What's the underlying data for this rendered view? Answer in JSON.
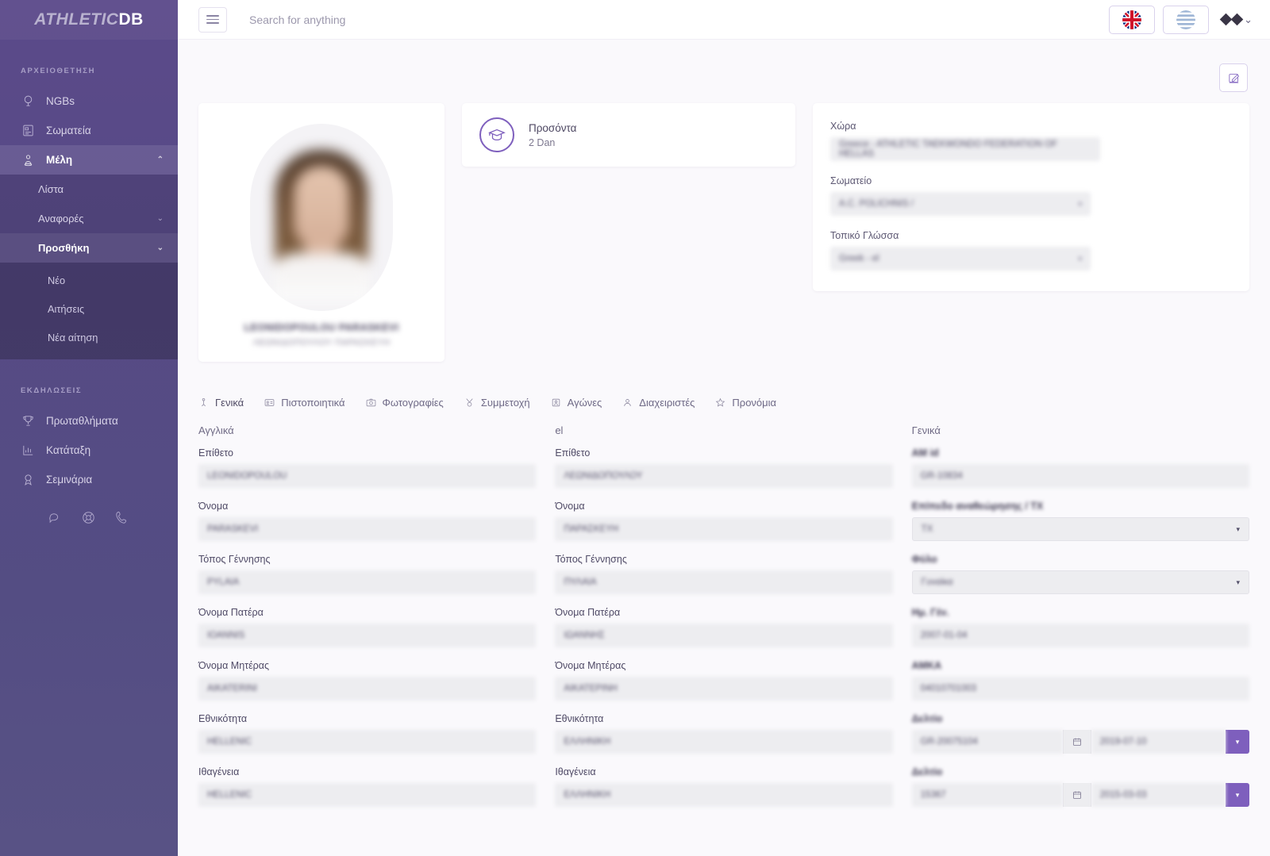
{
  "brand": {
    "part1": "ATHLETIC",
    "part2": "DB"
  },
  "sidebar": {
    "section1_title": "ΑΡΧΕΙΟΘΕΤΗΣΗ",
    "items": [
      {
        "label": "NGBs",
        "icon": "globe-icon"
      },
      {
        "label": "Σωματεία",
        "icon": "building-icon"
      },
      {
        "label": "Μέλη",
        "icon": "member-pin-icon",
        "chevron": "⌃"
      }
    ],
    "sub_items": [
      {
        "label": "Λίστα"
      },
      {
        "label": "Αναφορές",
        "chevron": "⌄"
      },
      {
        "label": "Προσθήκη",
        "chevron": "⌄"
      }
    ],
    "subsub_items": [
      {
        "label": "Νέο"
      },
      {
        "label": "Αιτήσεις"
      },
      {
        "label": "Νέα αίτηση"
      }
    ],
    "section2_title": "ΕΚΔΗΛΩΣΕΙΣ",
    "items2": [
      {
        "label": "Πρωταθλήματα",
        "icon": "trophy-icon"
      },
      {
        "label": "Κατάταξη",
        "icon": "bar-chart-icon"
      },
      {
        "label": "Σεμινάρια",
        "icon": "award-icon"
      }
    ],
    "social": [
      "chat-icon",
      "lifebuoy-icon",
      "phone-icon"
    ]
  },
  "topbar": {
    "search_placeholder": "Search for anything",
    "search_value": "",
    "lang_flag": "uk-flag-icon",
    "country_flag": "greece-flag-icon",
    "user_caret": "⌄"
  },
  "profile": {
    "name_latin": "LEONIDOPOULOU PARASKEVI",
    "name_greek": "ΛΕΩΝΙΔΟΠΟΥΛΟΥ ΠΑΡΑΣΚΕΥΗ"
  },
  "qualification": {
    "title": "Προσόντα",
    "value": "2 Dan",
    "icon": "graduation-cap-icon"
  },
  "org": {
    "country_label": "Χώρα",
    "country_value": "Greece - ATHLETIC TAEKWONDO FEDERATION OF HELLAS",
    "club_label": "Σωματείο",
    "club_value": "A.C. POLICHNIS /",
    "locale_label": "Τοπικό Γλώσσα",
    "locale_value": "Greek - el"
  },
  "tabs": [
    {
      "label": "Γενικά",
      "icon": "person-icon",
      "active": true
    },
    {
      "label": "Πιστοποιητικά",
      "icon": "card-icon"
    },
    {
      "label": "Φωτογραφίες",
      "icon": "camera-icon"
    },
    {
      "label": "Συμμετοχή",
      "icon": "medal-icon"
    },
    {
      "label": "Αγώνες",
      "icon": "contest-icon"
    },
    {
      "label": "Διαχειριστές",
      "icon": "user-icon"
    },
    {
      "label": "Προνόμια",
      "icon": "star-icon"
    }
  ],
  "form": {
    "col1": {
      "header": "Αγγλικά",
      "rows": [
        {
          "label": "Επίθετο",
          "value": "LEONIDOPOULOU"
        },
        {
          "label": "Όνομα",
          "value": "PARASKEVI"
        },
        {
          "label": "Τόπος Γέννησης",
          "value": "PYLAIA"
        },
        {
          "label": "Όνομα Πατέρα",
          "value": "IOANNIS"
        },
        {
          "label": "Όνομα Μητέρας",
          "value": "AIKATERINI"
        },
        {
          "label": "Εθνικότητα",
          "value": "HELLENIC"
        },
        {
          "label": "Ιθαγένεια",
          "value": "HELLENIC"
        }
      ]
    },
    "col2": {
      "header": "el",
      "rows": [
        {
          "label": "Επίθετο",
          "value": "ΛΕΩΝΙΔΟΠΟΥΛΟΥ"
        },
        {
          "label": "Όνομα",
          "value": "ΠΑΡΑΣΚΕΥΗ"
        },
        {
          "label": "Τόπος Γέννησης",
          "value": "ΠΥΛΑΙΑ"
        },
        {
          "label": "Όνομα Πατέρα",
          "value": "ΙΩΑΝΝΗΣ"
        },
        {
          "label": "Όνομα Μητέρας",
          "value": "ΑΙΚΑΤΕΡΙΝΗ"
        },
        {
          "label": "Εθνικότητα",
          "value": "ΕΛΛΗΝΙΚΗ"
        },
        {
          "label": "Ιθαγένεια",
          "value": "ΕΛΛΗΝΙΚΗ"
        }
      ]
    },
    "col3": {
      "header": "Γενικά",
      "rows": [
        {
          "label": "ΑΜ id",
          "value": "GR-10834",
          "type": "text"
        },
        {
          "label": "Επίπεδο αναθεώρησης / ΤΧ",
          "value": "ΤΧ",
          "type": "select"
        },
        {
          "label": "Φύλο",
          "value": "Γυναίκα",
          "type": "select"
        },
        {
          "label": "Ημ. Γέν.",
          "value": "2007-01-04",
          "type": "text"
        },
        {
          "label": "ΑΜΚΑ",
          "value": "04010701003",
          "type": "text"
        },
        {
          "label": "Δελτίο",
          "value": "GR-20075104",
          "value2": "2019-07-10",
          "type": "daterange"
        },
        {
          "label": "Δελτίο",
          "value": "15367",
          "value2": "2015-03-03",
          "type": "daterange"
        }
      ]
    }
  },
  "colors": {
    "accent": "#7e5fbd",
    "sidebar": "#564a85",
    "bg": "#faf9fc",
    "field": "#ededf0"
  }
}
